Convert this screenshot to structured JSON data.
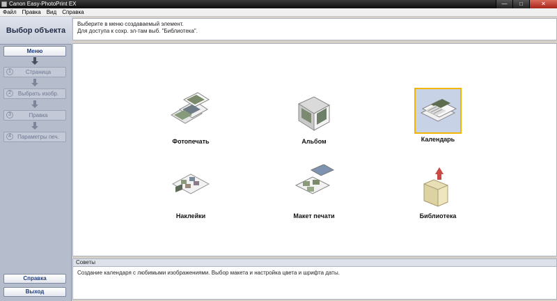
{
  "window": {
    "title": "Canon Easy-PhotoPrint EX",
    "minimize": "—",
    "maximize": "□",
    "close": "✕"
  },
  "menubar": [
    "Файл",
    "Правка",
    "Вид",
    "Справка"
  ],
  "sidebar": {
    "header": "Выбор объекта",
    "steps": [
      {
        "label": "Меню",
        "num": ""
      },
      {
        "label": "Страница",
        "num": "1"
      },
      {
        "label": "Выбрать изобр.",
        "num": "2"
      },
      {
        "label": "Правка",
        "num": "3"
      },
      {
        "label": "Параметры печ.",
        "num": "4"
      }
    ],
    "help_button": "Справка",
    "exit_button": "Выход"
  },
  "instructions": {
    "line1": "Выберите в меню создаваемый элемент.",
    "line2": "Для доступа к сохр. эл-там выб. \"Библиотека\"."
  },
  "items": [
    {
      "label": "Фотопечать",
      "icon": "photo-print-icon",
      "selected": false
    },
    {
      "label": "Альбом",
      "icon": "album-icon",
      "selected": false
    },
    {
      "label": "Календарь",
      "icon": "calendar-icon",
      "selected": true
    },
    {
      "label": "Наклейки",
      "icon": "stickers-icon",
      "selected": false
    },
    {
      "label": "Макет печати",
      "icon": "layout-print-icon",
      "selected": false
    },
    {
      "label": "Библиотека",
      "icon": "library-folder-icon",
      "selected": false
    }
  ],
  "tips": {
    "title": "Советы",
    "text": "Создание календаря с любимыми изображениями. Выбор макета и настройка цвета и шрифта даты."
  },
  "colors": {
    "accent": "#1f3b7a",
    "selection_border": "#f2b600",
    "sidebar_bg": "#b5bccb"
  }
}
